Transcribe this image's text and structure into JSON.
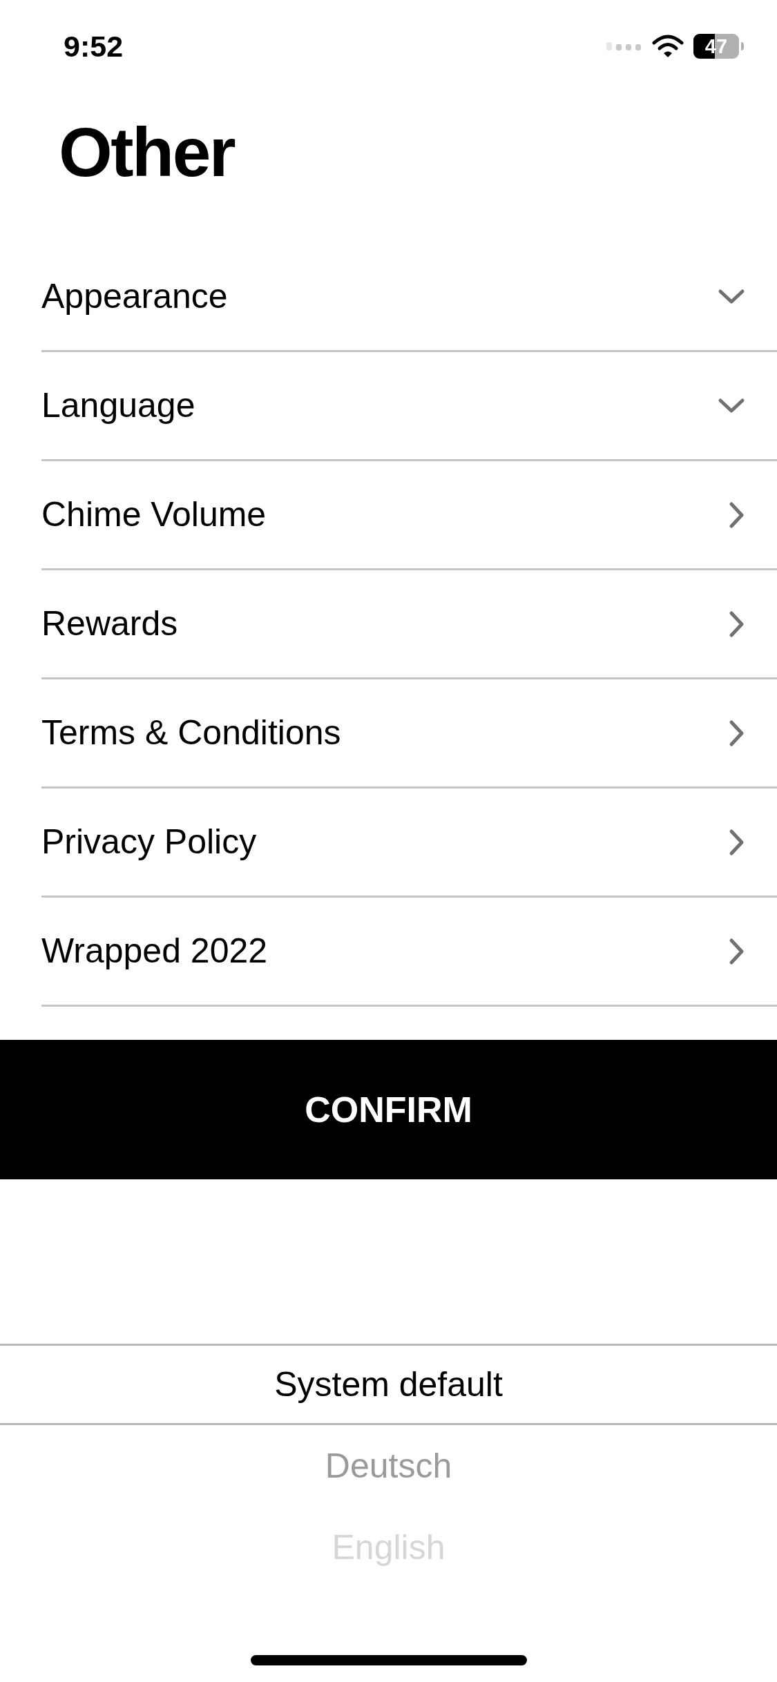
{
  "status_bar": {
    "time": "9:52",
    "battery": "47"
  },
  "title": "Other",
  "rows": [
    {
      "label": "Appearance",
      "kind": "dropdown"
    },
    {
      "label": "Language",
      "kind": "dropdown"
    },
    {
      "label": "Chime Volume",
      "kind": "link"
    },
    {
      "label": "Rewards",
      "kind": "link"
    },
    {
      "label": "Terms & Conditions",
      "kind": "link"
    },
    {
      "label": "Privacy Policy",
      "kind": "link"
    },
    {
      "label": "Wrapped 2022",
      "kind": "link"
    }
  ],
  "confirm_button": "CONFIRM",
  "picker": [
    {
      "label": "System default",
      "selected": true
    },
    {
      "label": "Deutsch",
      "selected": false
    },
    {
      "label": "English",
      "selected": false
    }
  ]
}
